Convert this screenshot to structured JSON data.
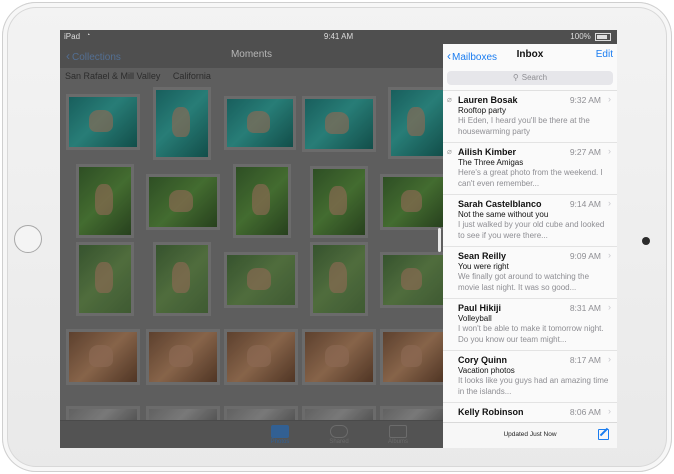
{
  "status_bar": {
    "carrier": "iPad",
    "wifi_icon": "wifi-icon",
    "time": "9:41 AM",
    "battery": "100%"
  },
  "photos": {
    "back_label": "Collections",
    "title": "Moments",
    "places": [
      "San Rafael & Mill Valley",
      "California"
    ],
    "tabs": [
      "Photos",
      "Shared",
      "Albums"
    ],
    "active_tab": "Photos"
  },
  "mail": {
    "back_label": "Mailboxes",
    "title": "Inbox",
    "edit_label": "Edit",
    "search_placeholder": "Search",
    "messages": [
      {
        "sender": "Lauren Bosak",
        "time": "9:32 AM",
        "subject": "Rooftop party",
        "preview": "Hi Eden, I heard you'll be there at the housewarming party",
        "attachment": true
      },
      {
        "sender": "Ailish Kimber",
        "time": "9:27 AM",
        "subject": "The Three Amigas",
        "preview": "Here's a great photo from the weekend. I can't even remember...",
        "attachment": true
      },
      {
        "sender": "Sarah Castelblanco",
        "time": "9:14 AM",
        "subject": "Not the same without you",
        "preview": "I just walked by your old cube and looked to see if you were there...",
        "attachment": false
      },
      {
        "sender": "Sean Reilly",
        "time": "9:09 AM",
        "subject": "You were right",
        "preview": "We finally got around to watching the movie last night. It was so good...",
        "attachment": false
      },
      {
        "sender": "Paul Hikiji",
        "time": "8:31 AM",
        "subject": "Volleyball",
        "preview": "I won't be able to make it tomorrow night. Do you know our team might...",
        "attachment": false
      },
      {
        "sender": "Cory Quinn",
        "time": "8:17 AM",
        "subject": "Vacation photos",
        "preview": "It looks like you guys had an amazing time in the islands...",
        "attachment": false
      },
      {
        "sender": "Kelly Robinson",
        "time": "8:06 AM",
        "subject": "",
        "preview": "",
        "attachment": false
      }
    ],
    "updated_label": "Updated Just Now",
    "accent_color": "#1a7cf0"
  }
}
